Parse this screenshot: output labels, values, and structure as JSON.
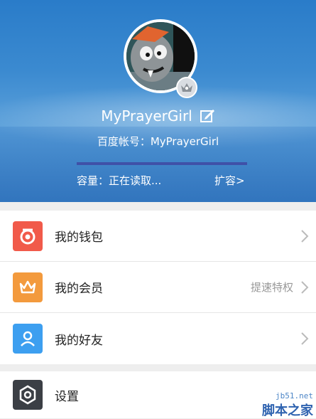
{
  "profile": {
    "username": "MyPrayerGirl",
    "account_line": "百度帐号：MyPrayerGirl",
    "capacity_text": "容量：正在读取...",
    "expand_label": "扩容>",
    "storage_progress": 1.0
  },
  "menu": {
    "wallet_label": "我的钱包",
    "member_label": "我的会员",
    "member_extra": "提速特权",
    "friends_label": "我的好友",
    "settings_label": "设置"
  },
  "colors": {
    "wallet": "#f15a4a",
    "member": "#f39a3d",
    "friends": "#3d9ff0",
    "settings": "#3b3f45",
    "progress": "#3f51a8"
  },
  "icons": {
    "wallet": "wallet-icon",
    "member": "crown-icon",
    "friends": "person-icon",
    "settings": "gear-icon",
    "edit": "edit-icon",
    "chevron": "chevron-right-icon"
  },
  "watermark": {
    "site": "jb51.net",
    "name": "脚本之家"
  }
}
